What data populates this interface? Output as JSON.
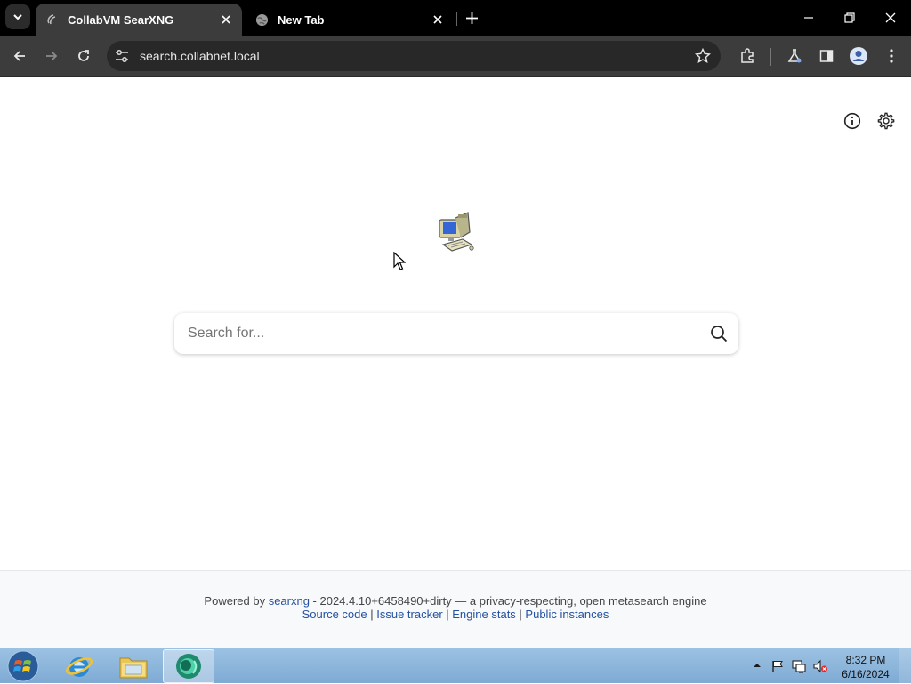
{
  "browser": {
    "tabs": [
      {
        "title": "CollabVM SearXNG",
        "active": true
      },
      {
        "title": "New Tab",
        "active": false
      }
    ],
    "url": "search.collabnet.local"
  },
  "page": {
    "search_placeholder": "Search for...",
    "footer": {
      "powered_by_prefix": "Powered by ",
      "powered_by_link": "searxng",
      "version_text": " - 2024.4.10+6458490+dirty — a privacy-respecting, open metasearch engine",
      "links": [
        "Source code",
        "Issue tracker",
        "Engine stats",
        "Public instances"
      ],
      "separator": " | "
    }
  },
  "taskbar": {
    "time": "8:32 PM",
    "date": "6/16/2024"
  },
  "colors": {
    "tabstrip": "#000000",
    "toolbar": "#3c3c3c",
    "footer_link": "#2451a0",
    "taskbar": "#8db6dc"
  },
  "icons": [
    "tab-list-icon",
    "searxng-favicon",
    "globe-icon",
    "close-icon",
    "plus-icon",
    "minimize-icon",
    "restore-icon",
    "back-arrow-icon",
    "forward-arrow-icon",
    "reload-icon",
    "site-settings-icon",
    "bookmark-star-icon",
    "extensions-icon",
    "labs-flask-icon",
    "side-panel-icon",
    "profile-avatar-icon",
    "kebab-menu-icon",
    "info-icon",
    "settings-gear-icon",
    "computer-logo-icon",
    "search-icon",
    "start-orb-icon",
    "internet-explorer-icon",
    "file-explorer-icon",
    "chrome-app-icon",
    "action-center-flag-icon",
    "network-icon",
    "volume-muted-icon"
  ]
}
